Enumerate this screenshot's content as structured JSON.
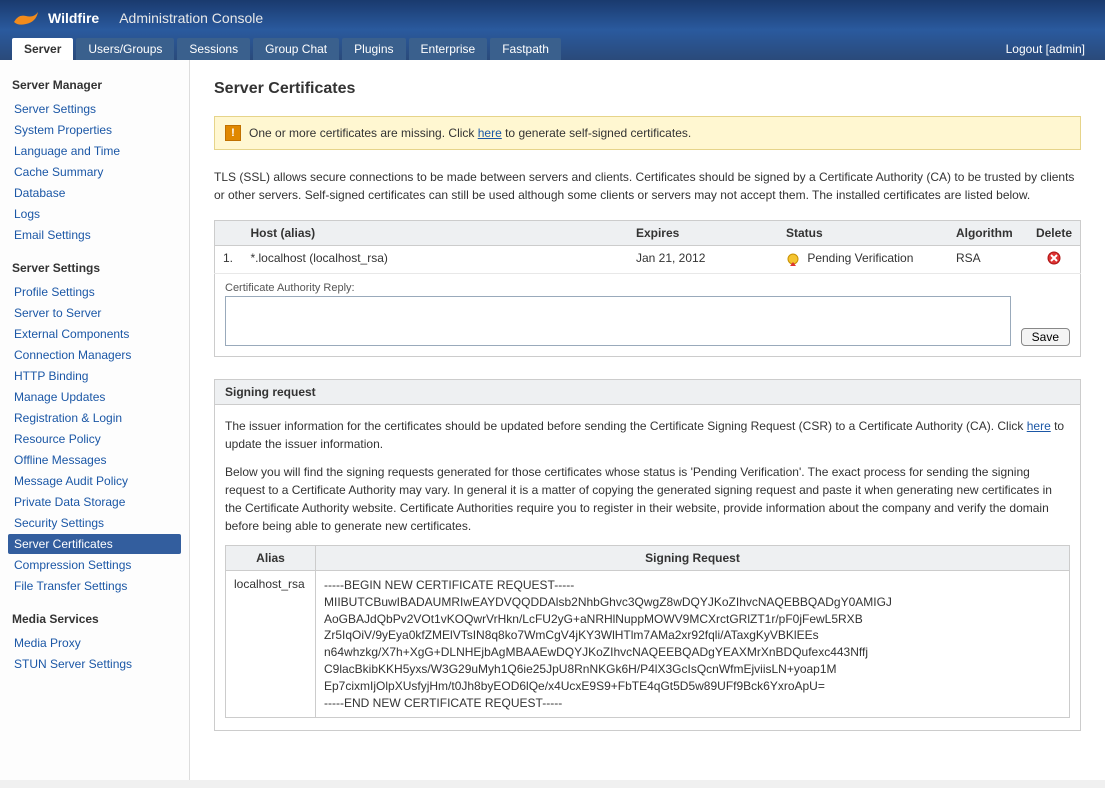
{
  "header": {
    "product": "Wildfire",
    "console": "Administration Console",
    "logout_label": "Logout",
    "user": "admin",
    "tabs": [
      {
        "label": "Server",
        "active": true
      },
      {
        "label": "Users/Groups",
        "active": false
      },
      {
        "label": "Sessions",
        "active": false
      },
      {
        "label": "Group Chat",
        "active": false
      },
      {
        "label": "Plugins",
        "active": false
      },
      {
        "label": "Enterprise",
        "active": false
      },
      {
        "label": "Fastpath",
        "active": false
      }
    ]
  },
  "sidebar": {
    "sections": [
      {
        "title": "Server Manager",
        "items": [
          {
            "label": "Server Settings"
          },
          {
            "label": "System Properties"
          },
          {
            "label": "Language and Time"
          },
          {
            "label": "Cache Summary"
          },
          {
            "label": "Database"
          },
          {
            "label": "Logs"
          },
          {
            "label": "Email Settings"
          }
        ]
      },
      {
        "title": "Server Settings",
        "items": [
          {
            "label": "Profile Settings"
          },
          {
            "label": "Server to Server"
          },
          {
            "label": "External Components"
          },
          {
            "label": "Connection Managers"
          },
          {
            "label": "HTTP Binding"
          },
          {
            "label": "Manage Updates"
          },
          {
            "label": "Registration & Login"
          },
          {
            "label": "Resource Policy"
          },
          {
            "label": "Offline Messages"
          },
          {
            "label": "Message Audit Policy"
          },
          {
            "label": "Private Data Storage"
          },
          {
            "label": "Security Settings"
          },
          {
            "label": "Server Certificates",
            "active": true
          },
          {
            "label": "Compression Settings"
          },
          {
            "label": "File Transfer Settings"
          }
        ]
      },
      {
        "title": "Media Services",
        "items": [
          {
            "label": "Media Proxy"
          },
          {
            "label": "STUN Server Settings"
          }
        ]
      }
    ]
  },
  "page": {
    "title": "Server Certificates",
    "warning": {
      "pre": "One or more certificates are missing. Click ",
      "link": "here",
      "post": " to generate self-signed certificates."
    },
    "intro": "TLS (SSL) allows secure connections to be made between servers and clients. Certificates should be signed by a Certificate Authority (CA) to be trusted by clients or other servers. Self-signed certificates can still be used although some clients or servers may not accept them. The installed certificates are listed below.",
    "cert_table": {
      "headers": {
        "host": "Host (alias)",
        "expires": "Expires",
        "status": "Status",
        "algorithm": "Algorithm",
        "delete": "Delete"
      },
      "rows": [
        {
          "num": "1.",
          "host": "*.localhost (localhost_rsa)",
          "expires": "Jan 21, 2012",
          "status": "Pending Verification",
          "algorithm": "RSA"
        }
      ],
      "ca_reply_label": "Certificate Authority Reply:",
      "save_label": "Save"
    },
    "signing": {
      "header": "Signing request",
      "p1_pre": "The issuer information for the certificates should be updated before sending the Certificate Signing Request (CSR) to a Certificate Authority (CA). Click ",
      "p1_link": "here",
      "p1_post": " to update the issuer information.",
      "p2": "Below you will find the signing requests generated for those certificates whose status is 'Pending Verification'. The exact process for sending the signing request to a Certificate Authority may vary. In general it is a matter of copying the generated signing request and paste it when generating new certificates in the Certificate Authority website. Certificate Authorities require you to register in their website, provide information about the company and verify the domain before being able to generate new certificates.",
      "table": {
        "headers": {
          "alias": "Alias",
          "request": "Signing Request"
        },
        "rows": [
          {
            "alias": "localhost_rsa",
            "csr": "-----BEGIN NEW CERTIFICATE REQUEST-----\nMIIBUTCBuwIBADAUMRIwEAYDVQQDDAlsb2NhbGhvc3QwgZ8wDQYJKoZIhvcNAQEBBQADgY0AMIGJ\nAoGBAJdQbPv2VOt1vKOQwrVrHkn/LcFU2yG+aNRHlNuppMOWV9MCXrctGRlZT1r/pF0jFewL5RXB\nZr5IqOiV/9yEya0kfZMElVTsIN8q8ko7WmCgV4jKY3WlHTlm7AMa2xr92fqli/ATaxgKyVBKlEEs\nn64whzkg/X7h+XgG+DLNHEjbAgMBAAEwDQYJKoZIhvcNAQEEBQADgYEAXMrXnBDQufexc443Nffj\nC9lacBkibKKH5yxs/W3G29uMyh1Q6ie25JpU8RnNKGk6H/P4lX3GcIsQcnWfmEjviisLN+yoap1M\nEp7cixmIjOlpXUsfyjHm/t0Jh8byEOD6lQe/x4UcxE9S9+FbTE4qGt5D5w89UFf9Bck6YxroApU=\n-----END NEW CERTIFICATE REQUEST-----"
          }
        ]
      }
    }
  }
}
